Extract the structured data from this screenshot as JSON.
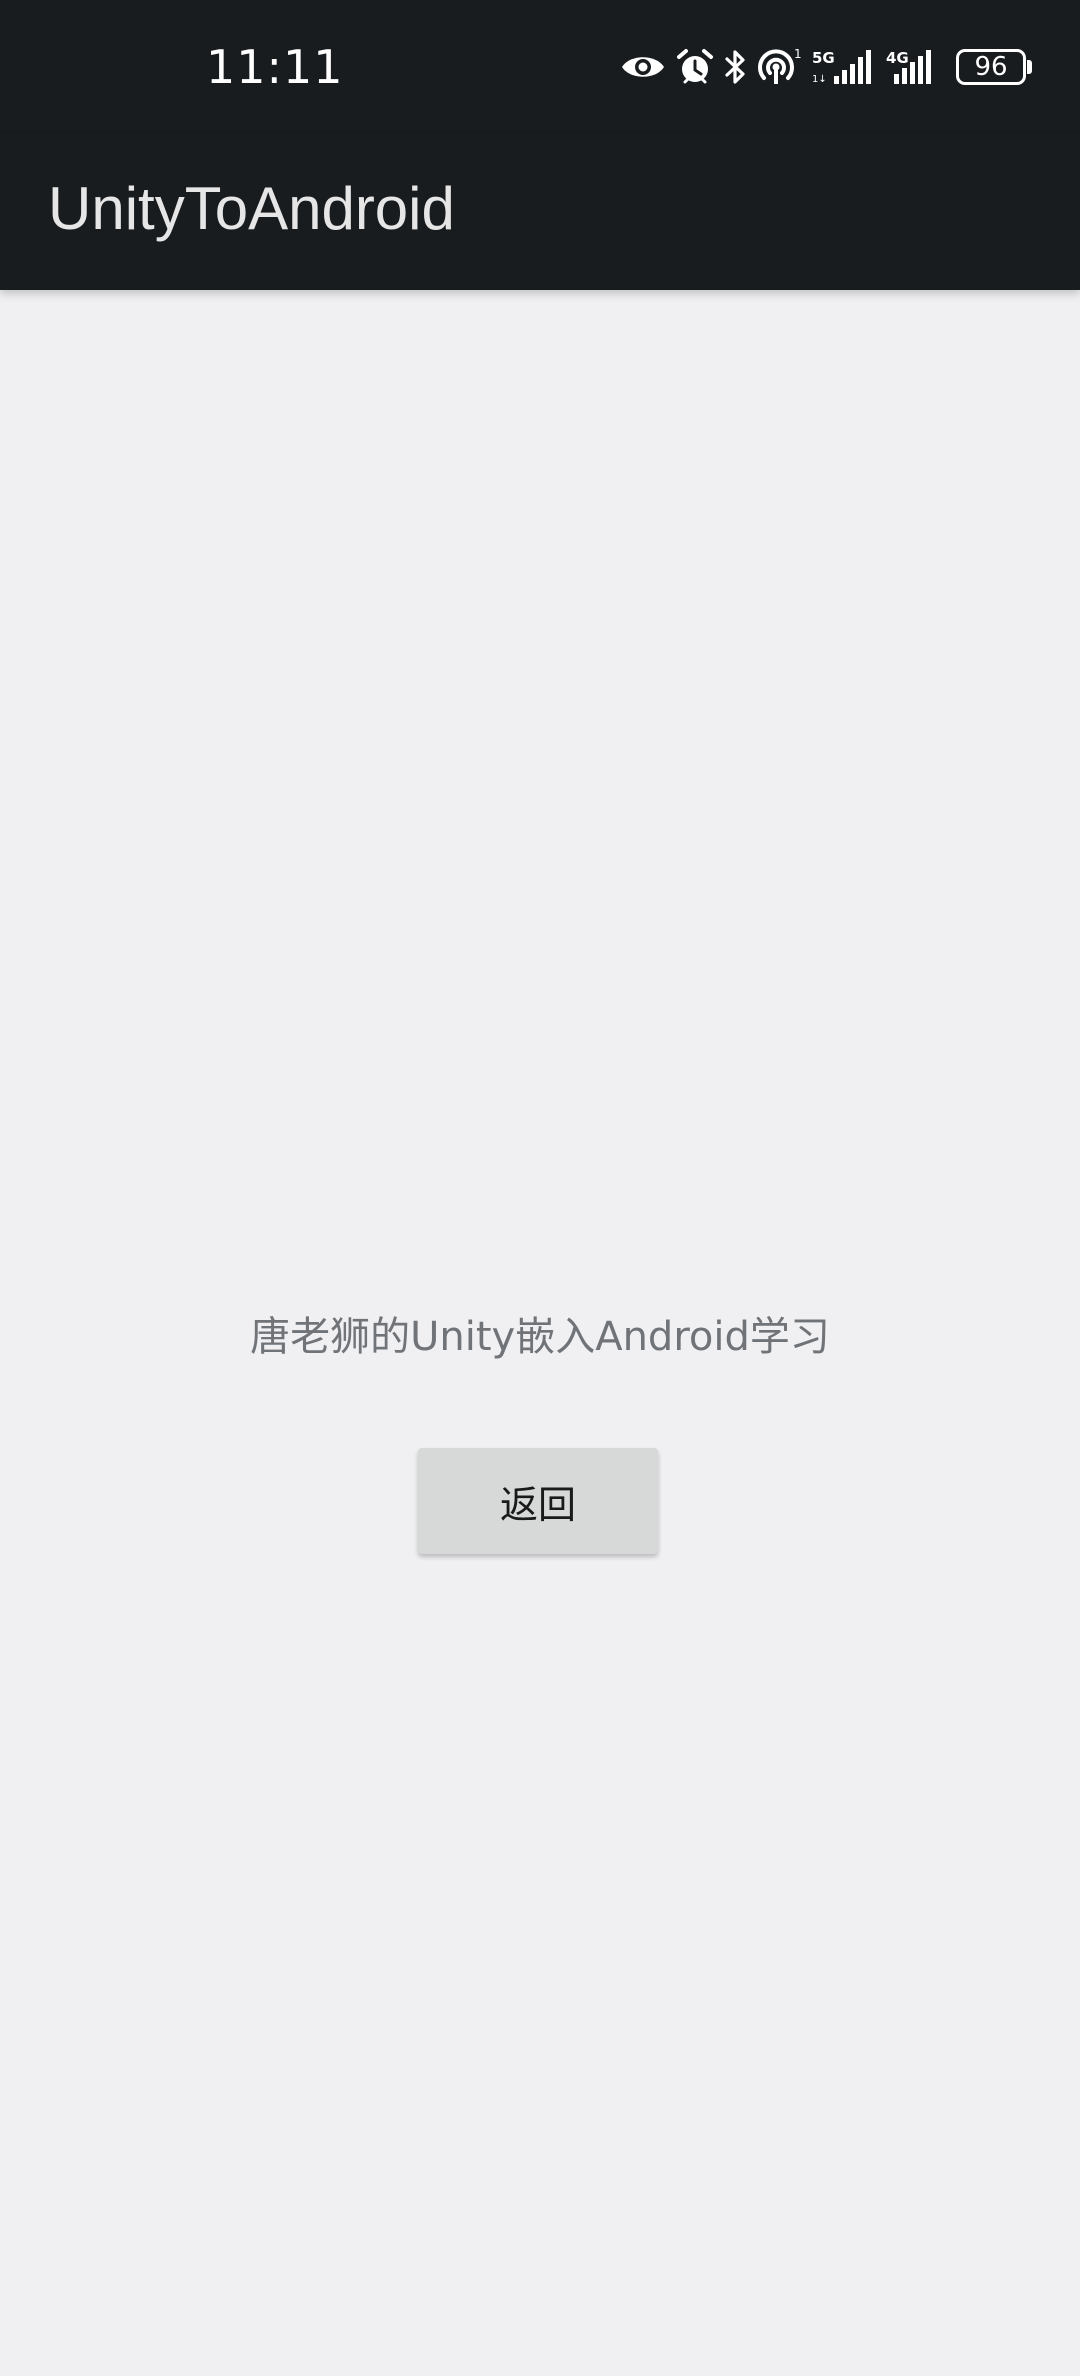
{
  "status_bar": {
    "time": "11:11",
    "network_5g": "5G",
    "network_4g": "4G",
    "battery_level": "96",
    "icons": [
      "eye-icon",
      "alarm-icon",
      "bluetooth-icon",
      "hotspot-icon",
      "signal-5g-icon",
      "signal-4g-icon",
      "battery-icon"
    ]
  },
  "app_bar": {
    "title": "UnityToAndroid"
  },
  "main": {
    "message": "唐老狮的Unity嵌入Android学习",
    "back_button_label": "返回"
  },
  "colors": {
    "bar_background": "#191c1f",
    "page_background": "#f0f0f2",
    "button_background": "#d7d8d8",
    "message_text": "#707378"
  }
}
